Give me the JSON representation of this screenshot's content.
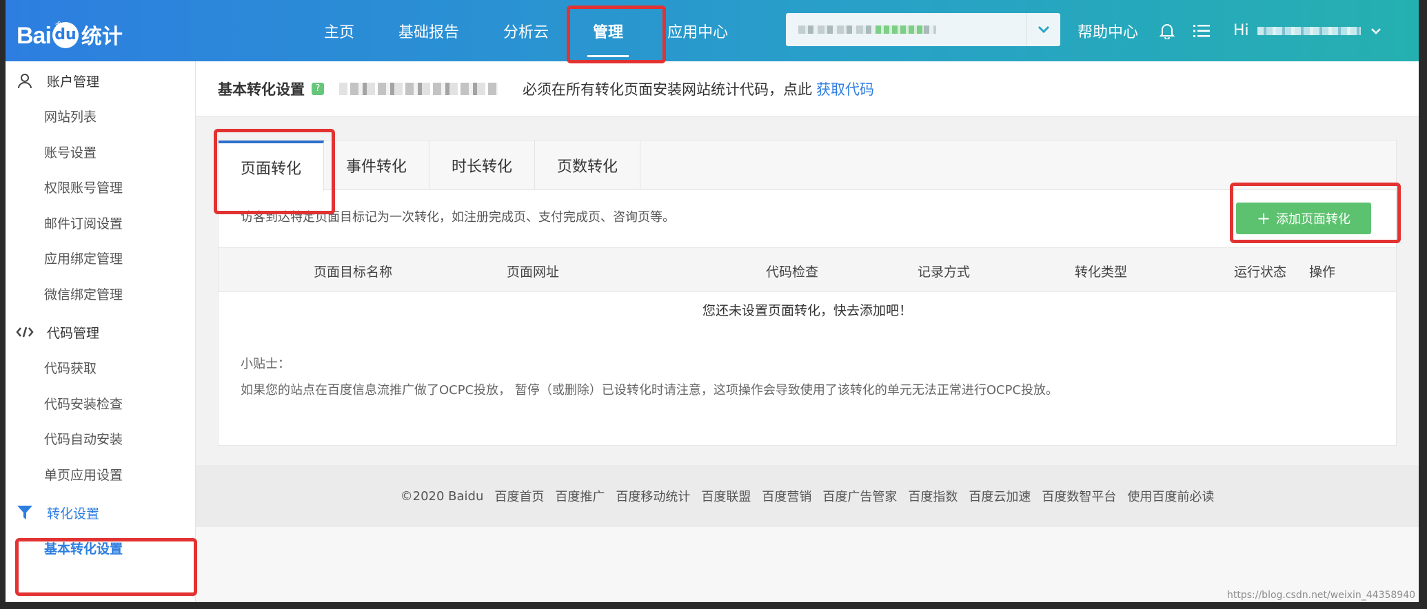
{
  "header": {
    "logo": {
      "bai": "Bai",
      "du": "du",
      "tongji": "统计"
    },
    "nav": [
      {
        "label": "主页"
      },
      {
        "label": "基础报告"
      },
      {
        "label": "分析云"
      },
      {
        "label": "管理"
      },
      {
        "label": "应用中心"
      }
    ],
    "help_label": "帮助中心",
    "hi_label": "Hi"
  },
  "sidebar": {
    "groups": [
      {
        "label": "账户管理",
        "icon": "user-icon",
        "items": [
          "网站列表",
          "账号设置",
          "权限账号管理",
          "邮件订阅设置",
          "应用绑定管理",
          "微信绑定管理"
        ]
      },
      {
        "label": "代码管理",
        "icon": "code-icon",
        "items": [
          "代码获取",
          "代码安装检查",
          "代码自动安装",
          "单页应用设置"
        ]
      },
      {
        "label": "转化设置",
        "icon": "filter-icon",
        "items": [
          "基本转化设置"
        ]
      }
    ]
  },
  "page": {
    "title": "基本转化设置",
    "help_mark": "?",
    "notice": "必须在所有转化页面安装网站统计代码，点此",
    "notice_link": "获取代码",
    "tabs": [
      "页面转化",
      "事件转化",
      "时长转化",
      "页数转化"
    ],
    "description": "访客到达特定页面目标记为一次转化，如注册完成页、支付完成页、咨询页等。",
    "add_button": "添加页面转化",
    "columns": [
      "页面目标名称",
      "页面网址",
      "代码检查",
      "记录方式",
      "转化类型",
      "运行状态",
      "操作"
    ],
    "empty_text": "您还未设置页面转化，快去添加吧！",
    "tip_title": "小贴士：",
    "tip_body": "如果您的站点在百度信息流推广做了OCPC投放， 暂停（或删除）已设转化时请注意，这项操作会导致使用了该转化的单元无法正常进行OCPC投放。"
  },
  "footer": {
    "links": [
      "©2020 Baidu",
      "百度首页",
      "百度推广",
      "百度移动统计",
      "百度联盟",
      "百度营销",
      "百度广告管家",
      "百度指数",
      "百度云加速",
      "百度数智平台",
      "使用百度前必读"
    ]
  },
  "watermark": "https://blog.csdn.net/weixin_44358940",
  "colors": {
    "accent": "#2d7ee0",
    "add_button": "#5dc26f",
    "highlight": "#e23232"
  }
}
